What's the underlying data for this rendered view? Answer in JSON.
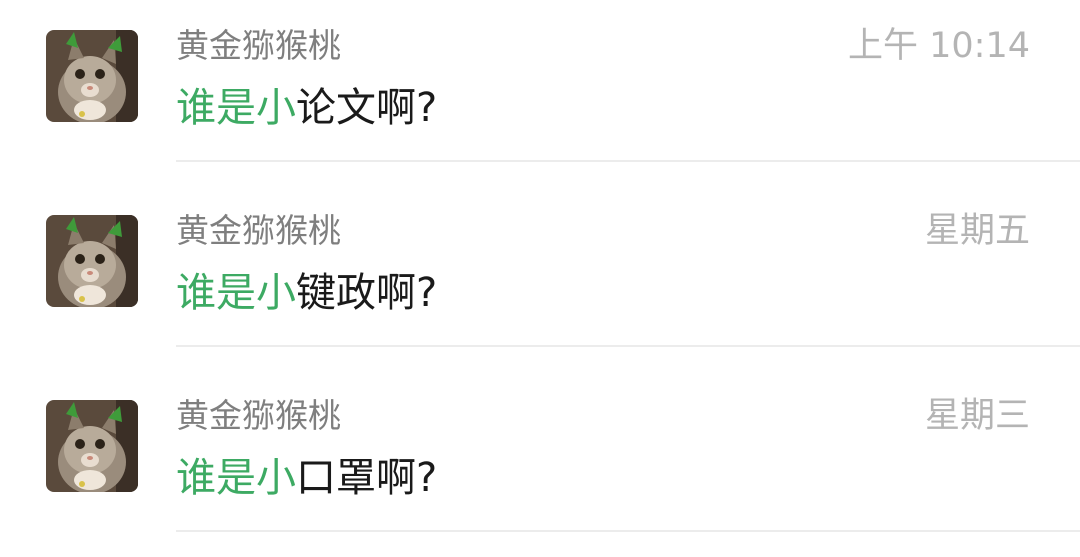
{
  "colors": {
    "name": "#7f7f7f",
    "time": "#b4b4b4",
    "message_highlight": "#3daa63",
    "message_text": "#1a1a1a",
    "divider": "#ececec"
  },
  "chats": [
    {
      "sender": "黄金猕猴桃",
      "time": "上午 10:14",
      "message_highlight": "谁是小",
      "message_rest": "论文啊?",
      "avatar_icon": "cat-avatar-icon"
    },
    {
      "sender": "黄金猕猴桃",
      "time": "星期五",
      "message_highlight": "谁是小",
      "message_rest": "键政啊?",
      "avatar_icon": "cat-avatar-icon"
    },
    {
      "sender": "黄金猕猴桃",
      "time": "星期三",
      "message_highlight": "谁是小",
      "message_rest": "口罩啊?",
      "avatar_icon": "cat-avatar-icon"
    }
  ]
}
